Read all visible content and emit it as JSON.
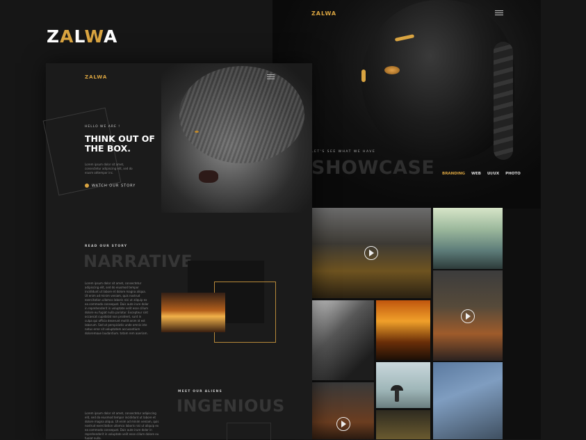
{
  "brand": {
    "part1": "Z",
    "part2": "A",
    "part3": "L",
    "part4": "W",
    "part5": "A"
  },
  "right": {
    "logo": "ZALWA",
    "kicker": "LET'S SEE WHAT WE HAVE",
    "title": "SHOWCASE",
    "filters": [
      "BRANDING",
      "WEB",
      "UI/UX",
      "PHOTO"
    ]
  },
  "left": {
    "logo": "ZALWA",
    "hello": "HELLO WE ARE !",
    "headline_line1": "THINK OUT OF",
    "headline_line2": "THE BOX.",
    "hero_sub": "Lorem ipsum dolor sit amet, consectetur adipiscing elit, sed do eiusm odtempor inc.",
    "watch": "WATCH OUR STORY",
    "story_kicker": "READ OUR STORY",
    "story_title": "NARRATIVE",
    "story_text": "Lorem ipsum dolor sit amet, consectetur adipiscing elit, sed do eiusmod tempor incididunt ut labore et dolore magna aliqua. Ut enim ad minim veniam, quis nostrud exercitation ullamco laboris nisi ut aliquip ex ea commodo consequat. Duis aute irure dolor in reprehenderit in voluptate velit esse cillum dolore eu fugiat nulla pariatur. Excepteur sint occaecat cupidatat non proident, sunt in culpa qui officia deserunt mollit anim id est laborum. Sed ut perspiciatis unde omnis iste natus error sit voluptatem accusantium doloremque laudantium, totam rem aperiam, eaque ipsa quae ab illo inventore veritatis et quasi architecto beatae vitae dicta sunt explicabo. Nemo enim ipsam voluptatem quia voluptas sit aspernatur aut odit aut fugit, sed quia consequuntur magni dolores eos qui ratione voluptatem sequi nesciunt. Neque porro quisquam est, qui dolorem ipsum quia dolor sit amet, consectetur, adipisci velit, sed quia non numquam eius modi tempora incidunt ut labore et dolore magnam aliquam quaerat voluptatem.",
    "team_kicker": "MEET OUR ALIENS",
    "team_title": "INGENIOUS",
    "team_text": "Lorem ipsum dolor sit amet, consectetur adipiscing elit, sed do eiusmod tempor incididunt ut labore et dolore magna aliqua. Ut enim ad minim veniam, quis nostrud exercitation ullamco laboris nisi ut aliquip ex ea commodo consequat. Duis aute irure dolor in reprehenderit in voluptate velit esse cillum dolore eu fugiat nulla."
  },
  "colors": {
    "accent": "#d9a441",
    "background": "#161616",
    "card": "#1b1b1b"
  }
}
